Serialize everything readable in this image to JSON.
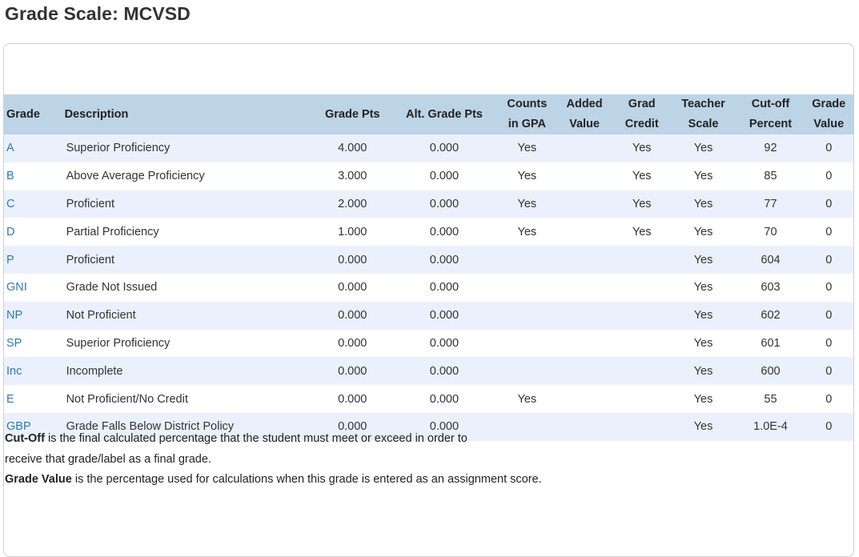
{
  "page": {
    "title": "Grade Scale: MCVSD"
  },
  "table": {
    "headers": {
      "grade": "Grade",
      "description": "Description",
      "grade_pts": "Grade Pts",
      "alt_grade_pts": "Alt. Grade Pts",
      "counts_in_gpa_1": "Counts",
      "counts_in_gpa_2": "in GPA",
      "added_value_1": "Added",
      "added_value_2": "Value",
      "grad_credit_1": "Grad",
      "grad_credit_2": "Credit",
      "teacher_scale_1": "Teacher",
      "teacher_scale_2": "Scale",
      "cutoff_percent_1": "Cut-off",
      "cutoff_percent_2": "Percent",
      "grade_value_1": "Grade",
      "grade_value_2": "Value"
    },
    "rows": [
      {
        "grade": "A",
        "description": "Superior Proficiency",
        "grade_pts": "4.000",
        "alt_grade_pts": "0.000",
        "counts_in_gpa": "Yes",
        "added_value": "",
        "grad_credit": "Yes",
        "teacher_scale": "Yes",
        "cutoff_percent": "92",
        "grade_value": "0"
      },
      {
        "grade": "B",
        "description": "Above Average Proficiency",
        "grade_pts": "3.000",
        "alt_grade_pts": "0.000",
        "counts_in_gpa": "Yes",
        "added_value": "",
        "grad_credit": "Yes",
        "teacher_scale": "Yes",
        "cutoff_percent": "85",
        "grade_value": "0"
      },
      {
        "grade": "C",
        "description": "Proficient",
        "grade_pts": "2.000",
        "alt_grade_pts": "0.000",
        "counts_in_gpa": "Yes",
        "added_value": "",
        "grad_credit": "Yes",
        "teacher_scale": "Yes",
        "cutoff_percent": "77",
        "grade_value": "0"
      },
      {
        "grade": "D",
        "description": "Partial Proficiency",
        "grade_pts": "1.000",
        "alt_grade_pts": "0.000",
        "counts_in_gpa": "Yes",
        "added_value": "",
        "grad_credit": "Yes",
        "teacher_scale": "Yes",
        "cutoff_percent": "70",
        "grade_value": "0"
      },
      {
        "grade": "P",
        "description": "Proficient",
        "grade_pts": "0.000",
        "alt_grade_pts": "0.000",
        "counts_in_gpa": "",
        "added_value": "",
        "grad_credit": "",
        "teacher_scale": "Yes",
        "cutoff_percent": "604",
        "grade_value": "0"
      },
      {
        "grade": "GNI",
        "description": "Grade Not Issued",
        "grade_pts": "0.000",
        "alt_grade_pts": "0.000",
        "counts_in_gpa": "",
        "added_value": "",
        "grad_credit": "",
        "teacher_scale": "Yes",
        "cutoff_percent": "603",
        "grade_value": "0"
      },
      {
        "grade": "NP",
        "description": "Not Proficient",
        "grade_pts": "0.000",
        "alt_grade_pts": "0.000",
        "counts_in_gpa": "",
        "added_value": "",
        "grad_credit": "",
        "teacher_scale": "Yes",
        "cutoff_percent": "602",
        "grade_value": "0"
      },
      {
        "grade": "SP",
        "description": "Superior Proficiency",
        "grade_pts": "0.000",
        "alt_grade_pts": "0.000",
        "counts_in_gpa": "",
        "added_value": "",
        "grad_credit": "",
        "teacher_scale": "Yes",
        "cutoff_percent": "601",
        "grade_value": "0"
      },
      {
        "grade": "Inc",
        "description": "Incomplete",
        "grade_pts": "0.000",
        "alt_grade_pts": "0.000",
        "counts_in_gpa": "",
        "added_value": "",
        "grad_credit": "",
        "teacher_scale": "Yes",
        "cutoff_percent": "600",
        "grade_value": "0"
      },
      {
        "grade": "E",
        "description": "Not Proficient/No Credit",
        "grade_pts": "0.000",
        "alt_grade_pts": "0.000",
        "counts_in_gpa": "Yes",
        "added_value": "",
        "grad_credit": "",
        "teacher_scale": "Yes",
        "cutoff_percent": "55",
        "grade_value": "0"
      },
      {
        "grade": "GBP",
        "description": "Grade Falls Below District Policy",
        "grade_pts": "0.000",
        "alt_grade_pts": "0.000",
        "counts_in_gpa": "",
        "added_value": "",
        "grad_credit": "",
        "teacher_scale": "Yes",
        "cutoff_percent": "1.0E-4",
        "grade_value": "0"
      }
    ]
  },
  "notes": {
    "cutoff_term": "Cut-Off",
    "cutoff_text_1": " is the final calculated percentage that the student must meet or exceed in order to",
    "cutoff_text_2": "receive that grade/label as a final grade.",
    "grade_value_term": "Grade Value",
    "grade_value_text": " is the percentage used for calculations when this grade is entered as an assignment score."
  },
  "colors": {
    "header_bg": "#bcd4e6",
    "row_alt_bg": "#eaf1fc",
    "link": "#2a7ab8",
    "text": "#333333"
  }
}
